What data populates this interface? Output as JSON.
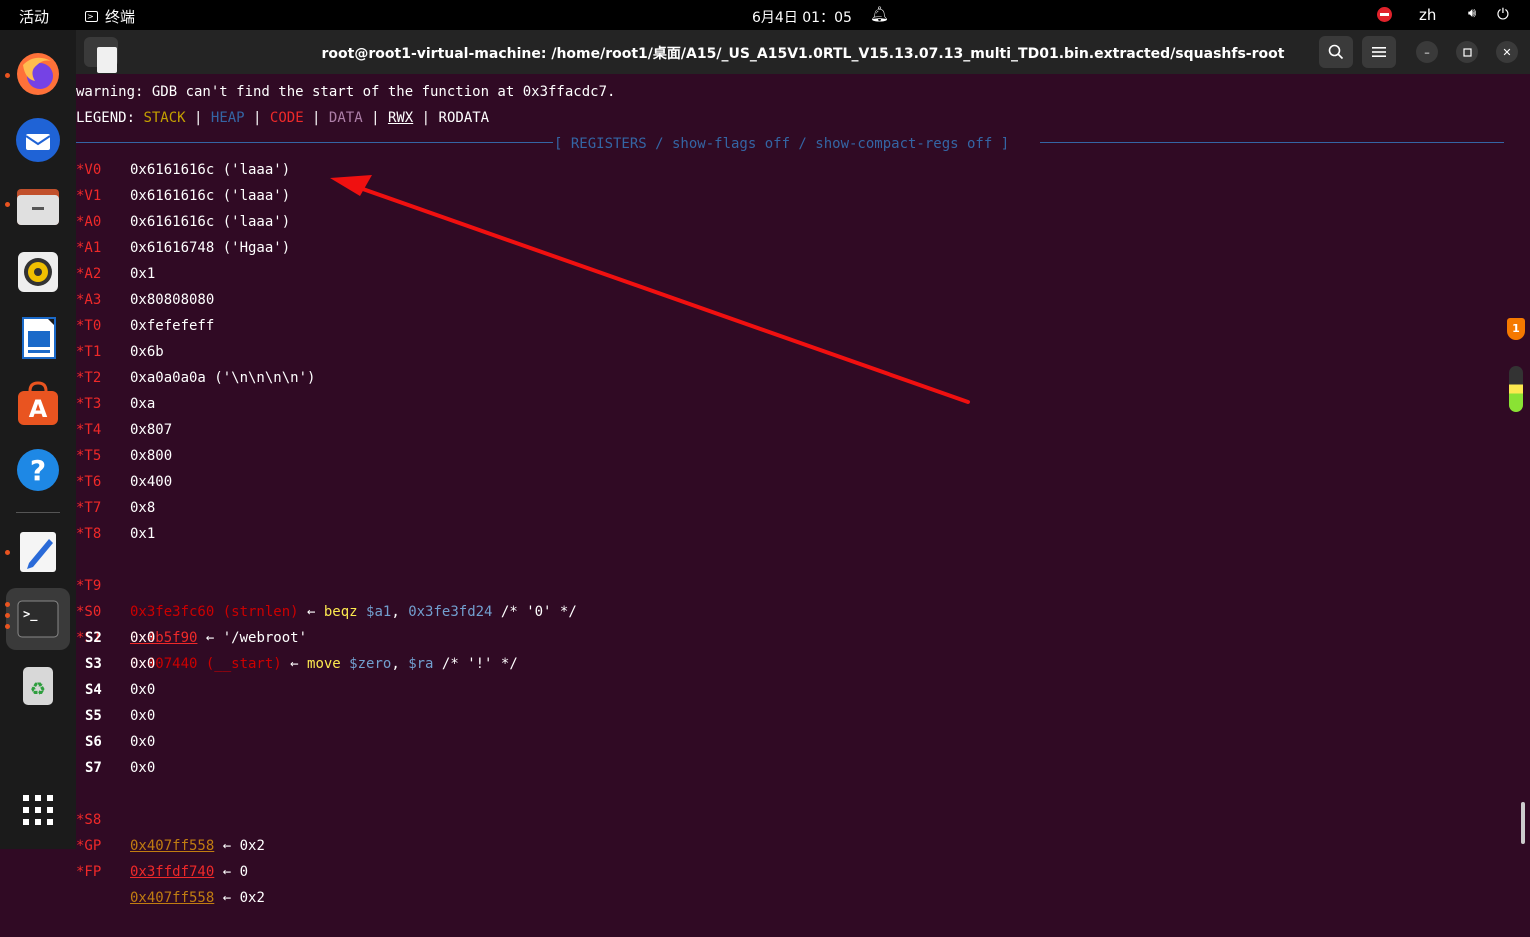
{
  "topbar": {
    "activities": "活动",
    "app_name": "终端",
    "clock": "6月4日  01：05",
    "lang": "zh"
  },
  "dock": {
    "items": [
      "firefox",
      "thunderbird",
      "files",
      "rhythmbox",
      "libreoffice-writer",
      "app-center",
      "help",
      "text-editor",
      "terminal",
      "trash",
      "show-apps"
    ]
  },
  "terminal": {
    "title": "root@root1-virtual-machine: /home/root1/桌面/A15/_US_A15V1.0RTL_V15.13.07.13_multi_TD01.bin.extracted/squashfs-root",
    "warning": "warning: GDB can't find the start of the function at 0x3ffacdc7.",
    "legend": {
      "prefix": "LEGEND: ",
      "stack": "STACK",
      "heap": "HEAP",
      "code": "CODE",
      "data": "DATA",
      "rwx": "RWX",
      "rodata": "RODATA",
      "sep": " | "
    },
    "section_header": "[ REGISTERS / show-flags off / show-compact-regs off ]",
    "registers": [
      {
        "name": "*V0",
        "value": "0x6161616c ('laaa')"
      },
      {
        "name": "*V1",
        "value": "0x6161616c ('laaa')"
      },
      {
        "name": "*A0",
        "value": "0x6161616c ('laaa')"
      },
      {
        "name": "*A1",
        "value": "0x61616748 ('Hgaa')"
      },
      {
        "name": "*A2",
        "value": "0x1"
      },
      {
        "name": "*A3",
        "value": "0x80808080"
      },
      {
        "name": "*T0",
        "value": "0xfefefeff"
      },
      {
        "name": "*T1",
        "value": "0x6b"
      },
      {
        "name": "*T2",
        "value": "0xa0a0a0a ('\\n\\n\\n\\n')"
      },
      {
        "name": "*T3",
        "value": "0xa"
      },
      {
        "name": "*T4",
        "value": "0x807"
      },
      {
        "name": "*T5",
        "value": "0x800"
      },
      {
        "name": "*T6",
        "value": "0x400"
      },
      {
        "name": "*T7",
        "value": "0x8"
      },
      {
        "name": "*T8",
        "value": "0x1"
      }
    ],
    "t9": {
      "name": "*T9",
      "addr": "0x3fe3fc60 (strnlen)",
      "arrow": " ← ",
      "op": "beqz",
      "reg": "$a1",
      "comma": ", ",
      "target": "0x3fe3fd24",
      "comment": " /* '0' */"
    },
    "s0": {
      "name": "*S0",
      "addr": "0x4b5f90",
      "arrow": " ← ",
      "str": "'/webroot'"
    },
    "s1": {
      "name": "*S1",
      "addr": "0x407440 (__start)",
      "arrow": " ← ",
      "op": "move",
      "reg1": "$zero",
      "comma": ", ",
      "reg2": "$ra",
      "comment": " /* '!' */"
    },
    "plain_regs": [
      {
        "name": "S2",
        "value": "0x0"
      },
      {
        "name": "S3",
        "value": "0x0"
      },
      {
        "name": "S4",
        "value": "0x0"
      },
      {
        "name": "S5",
        "value": "0x0"
      },
      {
        "name": "S6",
        "value": "0x0"
      },
      {
        "name": "S7",
        "value": "0x0"
      }
    ],
    "s8": {
      "name": "*S8",
      "addr": "0x407ff558",
      "arrow": " ← ",
      "val": "0x2"
    },
    "gp": {
      "name": "*GP",
      "addr": "0x3ffdf740",
      "arrow": " ← ",
      "val": "0"
    },
    "fp": {
      "name": "*FP",
      "addr": "0x407ff558",
      "arrow": " ← ",
      "val": "0x2"
    }
  },
  "overlay": {
    "shield_badge": "1"
  }
}
